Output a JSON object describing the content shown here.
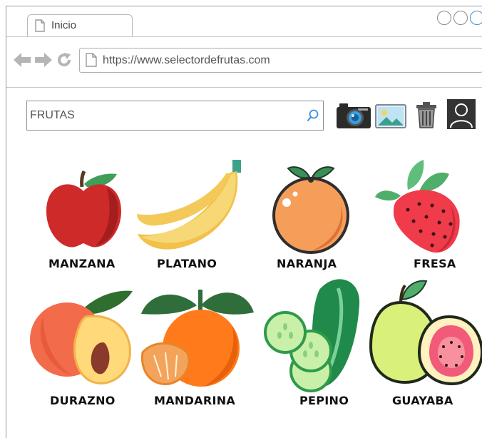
{
  "browser": {
    "tab_label": "Inicio",
    "url": "https://www.selectordefrutas.com"
  },
  "search": {
    "placeholder": "FRUTAS",
    "value": ""
  },
  "toolbar_icons": [
    "camera-icon",
    "image-icon",
    "trash-icon",
    "user-icon"
  ],
  "fruits": [
    {
      "label": "MANZANA"
    },
    {
      "label": "PLATANO"
    },
    {
      "label": "NARANJA"
    },
    {
      "label": "FRESA"
    },
    {
      "label": "DURAZNO"
    },
    {
      "label": "MANDARINA"
    },
    {
      "label": "PEPINO"
    },
    {
      "label": "GUAYABA"
    }
  ]
}
